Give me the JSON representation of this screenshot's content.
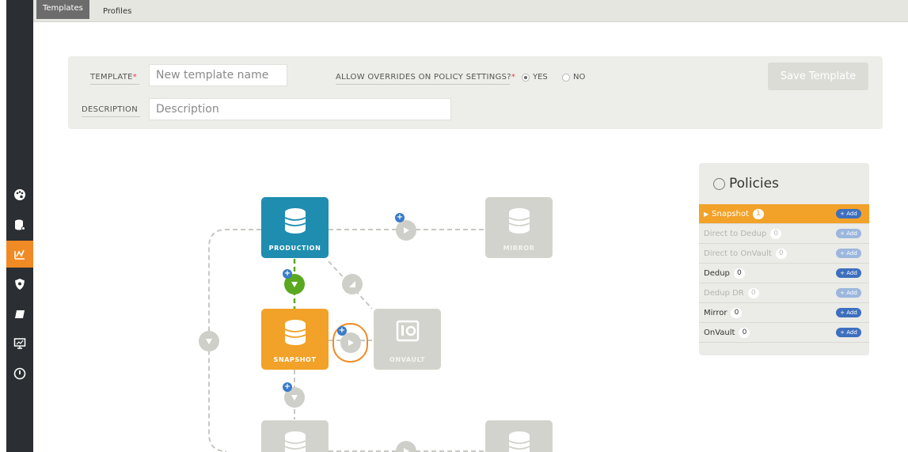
{
  "tabs": [
    {
      "label": "Templates",
      "active": true
    },
    {
      "label": "Profiles",
      "active": false
    }
  ],
  "sidebar": {
    "items": [
      {
        "icon": "palette-icon"
      },
      {
        "icon": "database-settings-icon"
      },
      {
        "icon": "workflow-icon",
        "active": true
      },
      {
        "icon": "shield-icon"
      },
      {
        "icon": "book-icon"
      },
      {
        "icon": "monitor-icon"
      },
      {
        "icon": "power-icon"
      }
    ]
  },
  "form": {
    "template_label": "TEMPLATE",
    "template_placeholder": "New template name",
    "description_label": "DESCRIPTION",
    "description_placeholder": "Description",
    "overrides_label": "ALLOW OVERRIDES ON POLICY SETTINGS?",
    "yes_label": "YES",
    "no_label": "NO",
    "selected": "YES",
    "save_label": "Save Template",
    "required_mark": "*"
  },
  "diagram": {
    "production_label": "PRODUCTION",
    "mirror_label": "MIRROR",
    "snapshot_label": "SNAPSHOT",
    "onvault_label": "ONVAULT"
  },
  "policies": {
    "title": "Policies",
    "add_label": "+ Add",
    "items": [
      {
        "name": "Snapshot",
        "count": "1",
        "state": "active"
      },
      {
        "name": "Direct to Dedup",
        "count": "0",
        "state": "dim"
      },
      {
        "name": "Direct to OnVault",
        "count": "0",
        "state": "dim"
      },
      {
        "name": "Dedup",
        "count": "0",
        "state": "normal"
      },
      {
        "name": "Dedup DR",
        "count": "0",
        "state": "dim"
      },
      {
        "name": "Mirror",
        "count": "0",
        "state": "normal"
      },
      {
        "name": "OnVault",
        "count": "0",
        "state": "normal"
      }
    ]
  },
  "colors": {
    "accent": "#f08a24",
    "production": "#1f8db0",
    "snapshot": "#f2a228",
    "connector_green": "#5aa820",
    "add_blue": "#3d6fbf"
  }
}
